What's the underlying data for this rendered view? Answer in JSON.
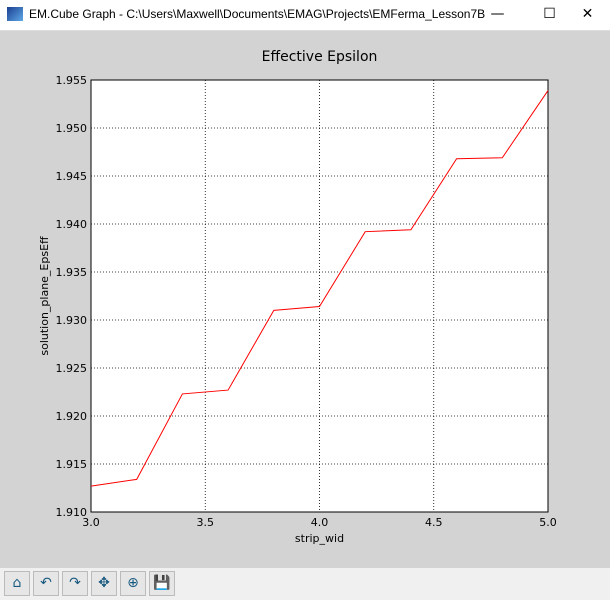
{
  "window": {
    "title": "EM.Cube Graph - C:\\Users\\Maxwell\\Documents\\EMAG\\Projects\\EMFerma_Lesson7B",
    "minimize": "—",
    "maximize": "☐",
    "close": "✕"
  },
  "toolbar": [
    {
      "name": "home-button",
      "icon": "⌂"
    },
    {
      "name": "back-button",
      "icon": "↶"
    },
    {
      "name": "forward-button",
      "icon": "↷"
    },
    {
      "name": "pan-button",
      "icon": "✥"
    },
    {
      "name": "zoom-button",
      "icon": "⊕"
    },
    {
      "name": "save-button",
      "icon": "💾"
    }
  ],
  "chart_data": {
    "type": "line",
    "title": "Effective Epsilon",
    "xlabel": "strip_wid",
    "ylabel": "solution_plane_EpsEff",
    "xlim": [
      3.0,
      5.0
    ],
    "ylim": [
      1.91,
      1.955
    ],
    "xticks": [
      "3.0",
      "3.5",
      "4.0",
      "4.5",
      "5.0"
    ],
    "yticks": [
      "1.910",
      "1.915",
      "1.920",
      "1.925",
      "1.930",
      "1.935",
      "1.940",
      "1.945",
      "1.950",
      "1.955"
    ],
    "grid": true,
    "series": [
      {
        "name": "EpsEff",
        "color": "#ff0000",
        "x": [
          3.0,
          3.2,
          3.4,
          3.6,
          3.8,
          4.0,
          4.2,
          4.4,
          4.6,
          4.8,
          5.0
        ],
        "y": [
          1.9127,
          1.9134,
          1.9223,
          1.9227,
          1.931,
          1.9314,
          1.9392,
          1.9394,
          1.9468,
          1.9469,
          1.9539
        ]
      }
    ]
  }
}
